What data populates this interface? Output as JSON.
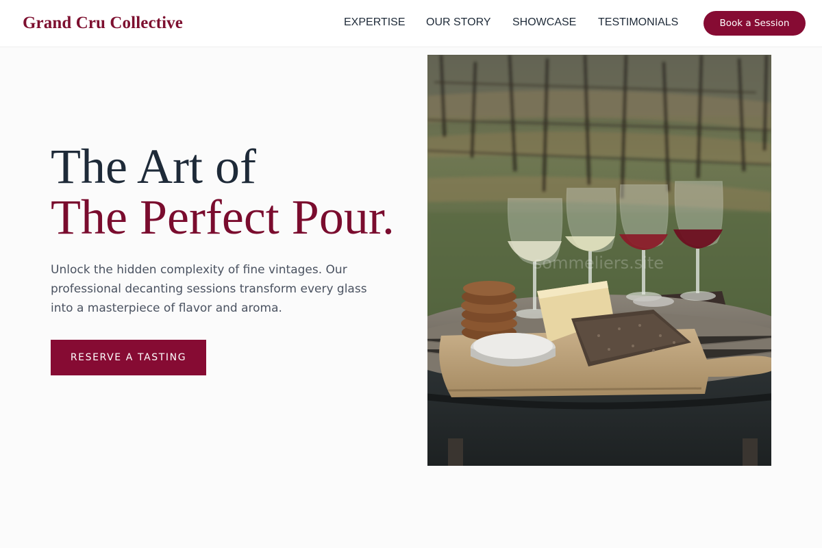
{
  "header": {
    "brand": "Grand Cru Collective",
    "nav": [
      {
        "label": "EXPERTISE"
      },
      {
        "label": "OUR STORY"
      },
      {
        "label": "SHOWCASE"
      },
      {
        "label": "TESTIMONIALS"
      }
    ],
    "cta_label": "Book a Session"
  },
  "hero": {
    "title_line1": "The Art of",
    "title_line2": "The Perfect Pour.",
    "subtitle": "Unlock the hidden complexity of fine vintages. Our professional decanting sessions transform every glass into a masterpiece of flavor and aroma.",
    "cta_label": "RESERVE A TASTING",
    "image": {
      "alt": "Wine flight glasses with cheese and crackers on a wooden board in a vineyard",
      "watermark": "sommeliers.site"
    }
  },
  "colors": {
    "accent": "#860b33",
    "brand": "#7d0f2f",
    "heading": "#1e2a38",
    "body_text": "#4a5260",
    "background": "#fbfbfb"
  }
}
